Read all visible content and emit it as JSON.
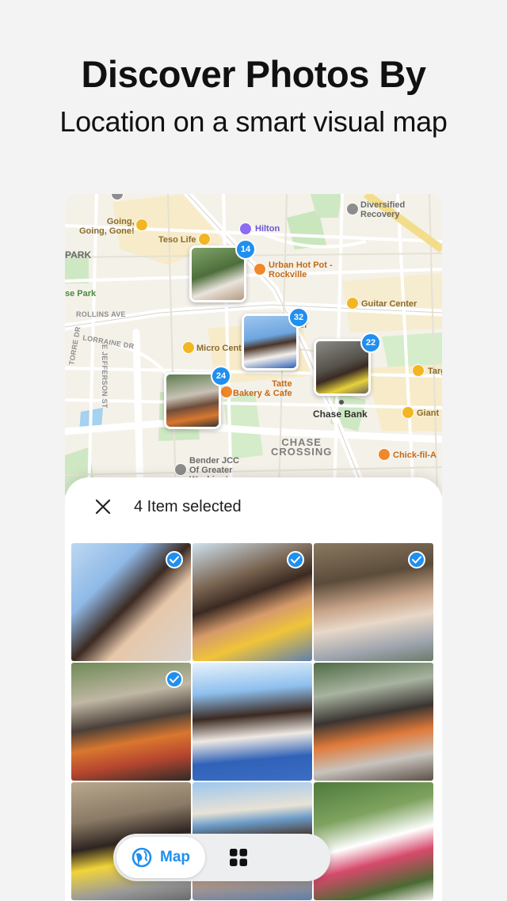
{
  "hero": {
    "title": "Discover Photos By",
    "subtitle": "Location on a smart visual map"
  },
  "map": {
    "labels": {
      "going": "Going,\nGoing, Gone!",
      "teso": "Teso Life",
      "hilton": "Hilton",
      "diversified": "Diversified\nRecovery",
      "park": "PARK",
      "se_park": "se Park",
      "urban": "Urban Hot Pot -\nRockville",
      "rollins": "ROLLINS AVE",
      "lorraine": "LORRAINE DR",
      "jefferson": "E JEFFERSON ST",
      "torre": "TORRE DR",
      "micro": "Micro Cent",
      "guitar": "Guitar Center",
      "er": "er",
      "tatte": "Tatte\nBakery & Cafe",
      "chase_bank": "Chase Bank",
      "target": "Targ",
      "giant": "Giant",
      "chase_crossing": "CHASE\nCROSSING",
      "chickfila": "Chick-fil-A",
      "bender": "Bender JCC\nOf Greater\nWashington"
    },
    "clusters": [
      {
        "count": "14"
      },
      {
        "count": "32"
      },
      {
        "count": "22"
      },
      {
        "count": "24"
      }
    ]
  },
  "selection": {
    "text": "4 Item selected"
  },
  "photos": [
    {
      "selected": true
    },
    {
      "selected": true
    },
    {
      "selected": true
    },
    {
      "selected": true
    },
    {
      "selected": false
    },
    {
      "selected": false
    },
    {
      "selected": false
    },
    {
      "selected": false
    },
    {
      "selected": false
    }
  ],
  "toolbar": {
    "map_label": "Map",
    "map_icon": "map-globe-icon",
    "grid_icon": "grid-icon"
  },
  "colors": {
    "accent": "#1f8ff0",
    "background": "#f3f3f3",
    "map_background": "#f4f1e9"
  }
}
